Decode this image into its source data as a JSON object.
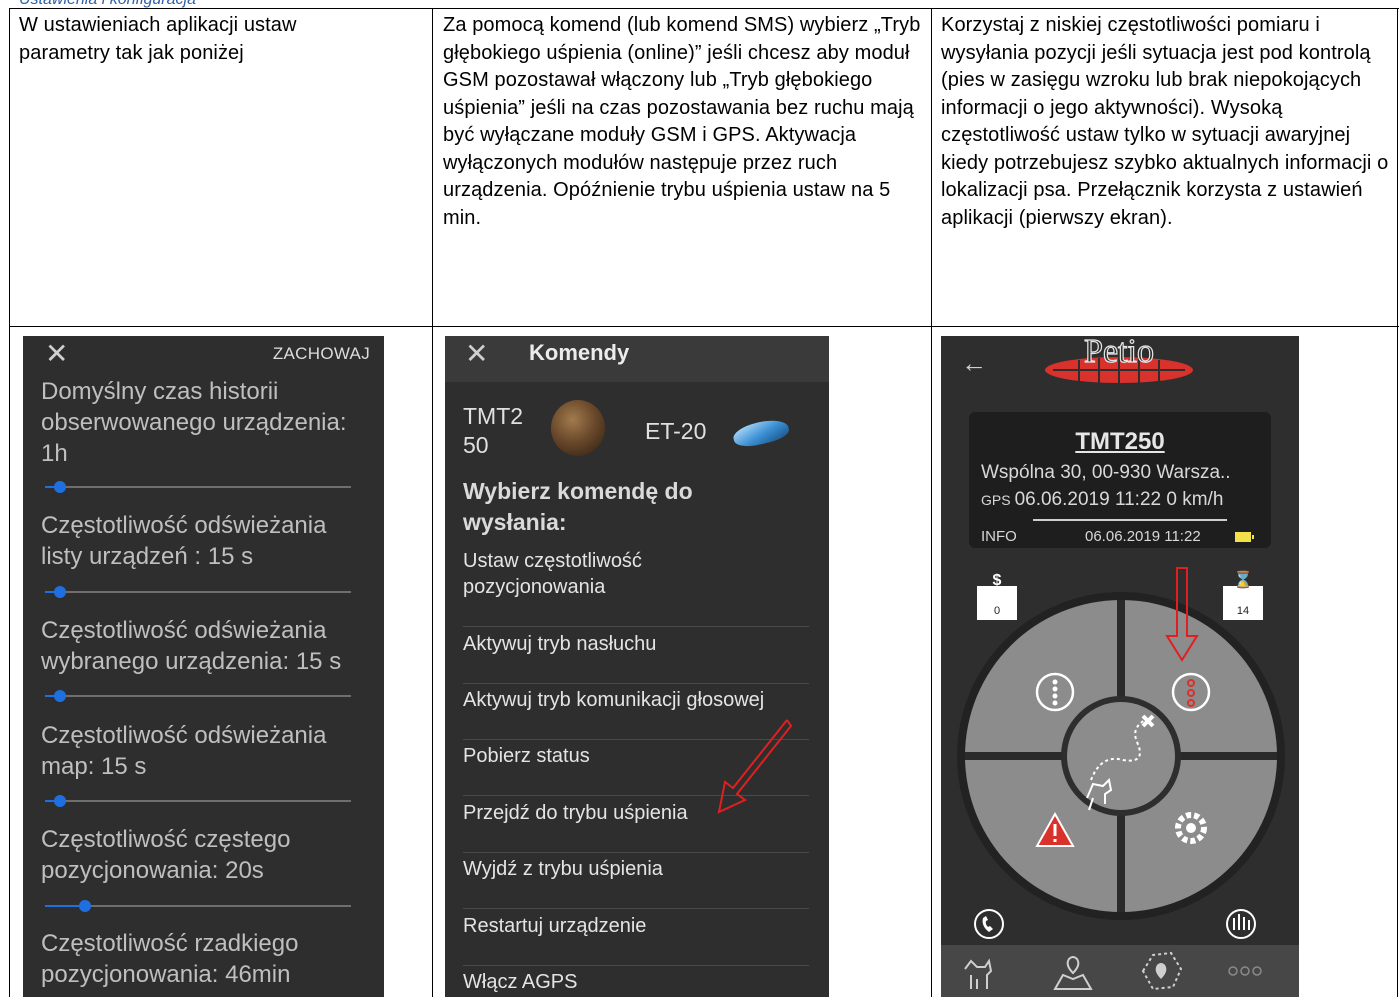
{
  "header_link": "Ustawienia i konfiguracja",
  "columns": [
    {
      "text": "W ustawieniach aplikacji ustaw parametry tak jak poniżej"
    },
    {
      "text": "Za pomocą komend (lub komend SMS) wybierz „Tryb głębokiego uśpienia (online)” jeśli chcesz aby moduł GSM pozostawał włączony lub „Tryb głębokiego uśpienia” jeśli na czas pozostawania bez ruchu mają być wyłączane moduły GSM i GPS. Aktywacja wyłączonych modułów następuje przez ruch urządzenia. Opóźnienie trybu uśpienia ustaw na 5 min."
    },
    {
      "text": "Korzystaj z niskiej częstotliwości pomiaru i wysyłania pozycji jeśli sytuacja jest pod kontrolą (pies w zasięgu wzroku lub brak niepokojących informacji o jego aktywności). Wysoką częstotliwość ustaw tylko w sytuacji awaryjnej kiedy potrzebujesz szybko aktualnych informacji o lokalizacji psa. Przełącznik korzysta z ustawień aplikacji (pierwszy ekran)."
    }
  ],
  "settings_screen": {
    "close_glyph": "✕",
    "save_label": "ZACHOWAJ",
    "items": [
      {
        "label": "Domyślny czas historii obserwowanego urządzenia: 1h",
        "level": 0.05
      },
      {
        "label": "Częstotliwość odświeżania listy urządzeń : 15 s",
        "level": 0.05
      },
      {
        "label": "Częstotliwość odświeżania wybranego urządzenia: 15 s",
        "level": 0.05
      },
      {
        "label": "Częstotliwość odświeżania map: 15 s",
        "level": 0.05
      },
      {
        "label": "Częstotliwość częstego pozycjonowania: 20s",
        "level": 0.13
      },
      {
        "label": "Częstotliwość rzadkiego pozycjonowania: 46min"
      }
    ]
  },
  "commands_screen": {
    "close_glyph": "✕",
    "title": "Komendy",
    "device_1": "TMT250",
    "device_2": "ET-20",
    "choose_label": "Wybierz komendę do wysłania:",
    "commands": [
      "Ustaw częstotliwość pozycjonowania",
      "Aktywuj tryb nasłuchu",
      "Aktywuj tryb komunikacji głosowej",
      "Pobierz status",
      "Przejdź do trybu uśpienia",
      "Wyjdź z trybu uśpienia",
      "Restartuj urządzenie",
      "Włącz AGPS"
    ]
  },
  "petio_screen": {
    "back_glyph": "←",
    "logo_text": "Petio",
    "device_name": "TMT250",
    "address": "Wspólna 30, 00-930 Warsza..",
    "gps_tag": "GPS",
    "gps_value": "06.06.2019 11:22  0 km/h",
    "info_label": "INFO",
    "info_date": "06.06.2019 11:22",
    "left_badge_symbol": "$",
    "left_badge_value": "0",
    "right_badge_symbol": "⌛",
    "right_badge_value": "14",
    "colors": {
      "accent_red": "#d9312b",
      "arrow_red": "#e02020",
      "battery": "#f2e14a"
    }
  }
}
